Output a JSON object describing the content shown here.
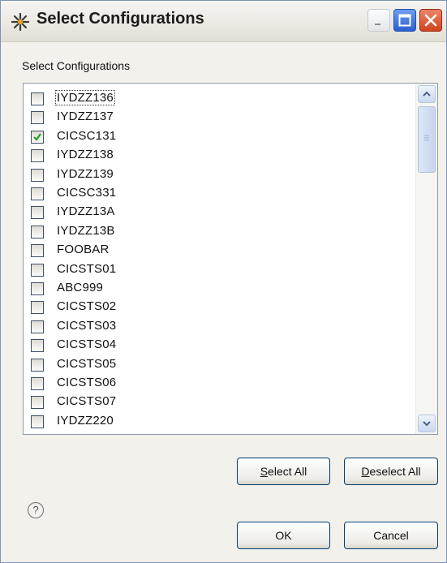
{
  "window": {
    "title": "Select Configurations",
    "icon": "eclipse-star-icon"
  },
  "group_label": "Select Configurations",
  "configurations": [
    {
      "label": "IYDZZ136",
      "checked": false,
      "focused": true
    },
    {
      "label": "IYDZZ137",
      "checked": false
    },
    {
      "label": "CICSC131",
      "checked": true
    },
    {
      "label": "IYDZZ138",
      "checked": false
    },
    {
      "label": "IYDZZ139",
      "checked": false
    },
    {
      "label": "CICSC331",
      "checked": false
    },
    {
      "label": "IYDZZ13A",
      "checked": false
    },
    {
      "label": "IYDZZ13B",
      "checked": false
    },
    {
      "label": "FOOBAR",
      "checked": false
    },
    {
      "label": "CICSTS01",
      "checked": false
    },
    {
      "label": "ABC999",
      "checked": false
    },
    {
      "label": "CICSTS02",
      "checked": false
    },
    {
      "label": "CICSTS03",
      "checked": false
    },
    {
      "label": "CICSTS04",
      "checked": false
    },
    {
      "label": "CICSTS05",
      "checked": false
    },
    {
      "label": "CICSTS06",
      "checked": false
    },
    {
      "label": "CICSTS07",
      "checked": false
    },
    {
      "label": "IYDZZ220",
      "checked": false
    }
  ],
  "buttons": {
    "select_all": {
      "mnemonic": "S",
      "rest": "elect All"
    },
    "deselect_all": {
      "mnemonic": "D",
      "rest": "eselect All"
    },
    "ok": "OK",
    "cancel": "Cancel"
  },
  "help_symbol": "?",
  "colors": {
    "check": "#21a121",
    "close_button": "#d1431f",
    "maximize_button": "#2a5fcf"
  }
}
